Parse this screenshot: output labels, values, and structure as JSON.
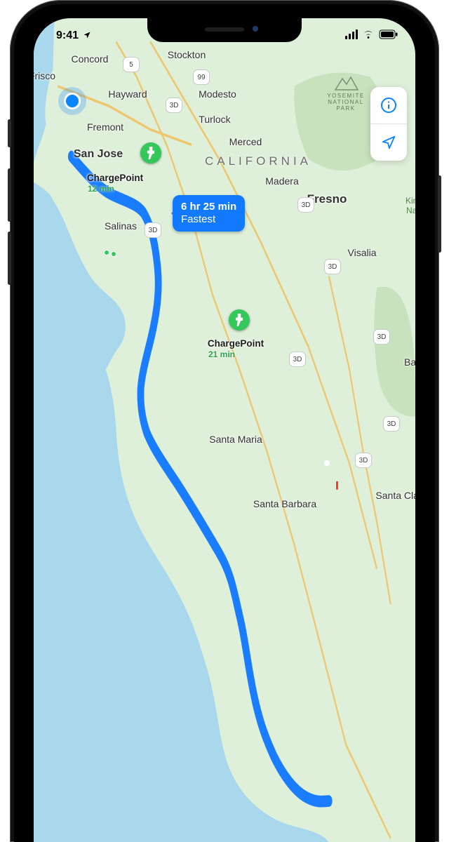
{
  "status_bar": {
    "time": "9:41"
  },
  "map": {
    "state_label": "CALIFORNIA",
    "parks": {
      "yosemite": "YOSEMITE\nNATIONAL\nPARK",
      "kings": "Kings\nNatio"
    },
    "cities": {
      "concord": "Concord",
      "stockton": "Stockton",
      "frisco": "Frisco",
      "hayward": "Hayward",
      "modesto": "Modesto",
      "fremont": "Fremont",
      "turlock": "Turlock",
      "san_jose": "San Jose",
      "merced": "Merced",
      "madera": "Madera",
      "fresno": "Fresno",
      "salinas": "Salinas",
      "visalia": "Visalia",
      "bake": "Bake",
      "santa_maria": "Santa Maria",
      "santa_barbara": "Santa Barbara",
      "santa_clarit": "Santa Clarit"
    },
    "shields": {
      "s5a": "5",
      "s99a": "99",
      "s3d1": "3D",
      "s3d2": "3D",
      "s3d3": "3D",
      "s3d4": "3D",
      "s3d5": "3D",
      "s3d6": "3D",
      "s3d7": "3D",
      "s3d8": "3D"
    },
    "charge_stops": [
      {
        "name": "ChargePoint",
        "time": "12 min"
      },
      {
        "name": "ChargePoint",
        "time": "21 min"
      }
    ],
    "route_callout": {
      "duration": "6 hr 25 min",
      "label": "Fastest"
    }
  }
}
